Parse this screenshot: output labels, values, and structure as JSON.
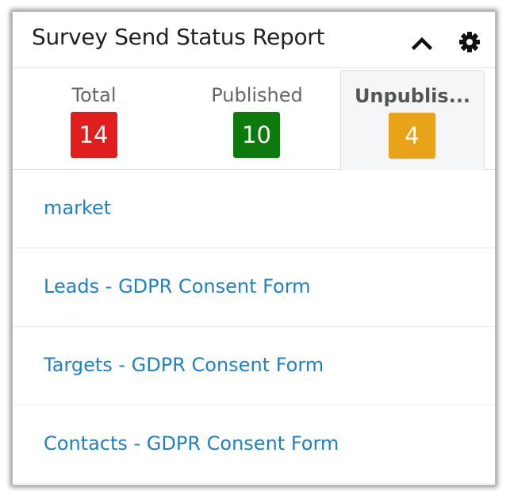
{
  "widget": {
    "title": "Survey Send Status Report"
  },
  "header_icons": {
    "collapse": "chevron-up-icon",
    "settings": "gear-icon"
  },
  "tabs": [
    {
      "label": "Total",
      "count": "14",
      "color": "#e01e1e"
    },
    {
      "label": "Published",
      "count": "10",
      "color": "#0e7a0d"
    },
    {
      "label": "Unpublis...",
      "count": "4",
      "color": "#e8a31a"
    }
  ],
  "selected_tab": "Unpublis...",
  "surveys": [
    {
      "name": "market"
    },
    {
      "name": "Leads - GDPR Consent Form"
    },
    {
      "name": "Targets - GDPR Consent Form"
    },
    {
      "name": "Contacts - GDPR Consent Form"
    }
  ]
}
